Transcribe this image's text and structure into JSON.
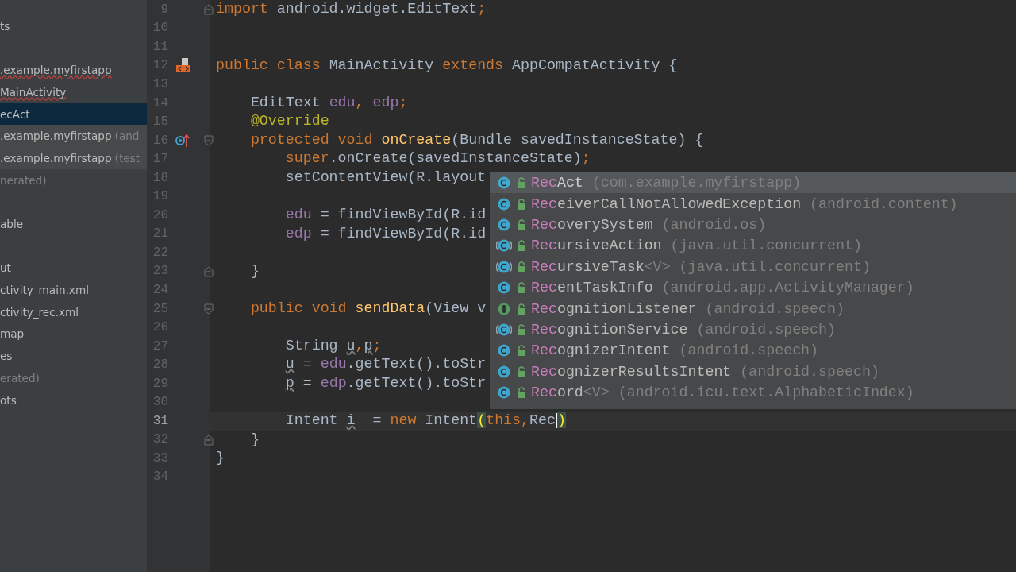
{
  "sidebar": {
    "groups": [
      [
        {
          "text": "ts",
          "kind": "plain",
          "selected": false
        }
      ],
      [
        {
          "text": ".example.myfirstapp",
          "kind": "error",
          "selected": false
        },
        {
          "text": "MainActivity",
          "kind": "error",
          "selected": false
        },
        {
          "text": "ecAct",
          "kind": "plain",
          "selected": true
        },
        {
          "text": ".example.myfirstapp",
          "note": "(and",
          "kind": "test",
          "selected": false
        },
        {
          "text": ".example.myfirstapp",
          "note": "(test",
          "kind": "test",
          "selected": false
        },
        {
          "text": "nerated)",
          "kind": "muted",
          "selected": false
        }
      ],
      [
        {
          "text": "able",
          "kind": "plain",
          "selected": false
        }
      ],
      [
        {
          "text": "ut",
          "kind": "plain",
          "selected": false
        },
        {
          "text": "ctivity_main.xml",
          "kind": "plain",
          "selected": false
        },
        {
          "text": "ctivity_rec.xml",
          "kind": "plain",
          "selected": false
        },
        {
          "text": "map",
          "kind": "plain",
          "selected": false
        },
        {
          "text": "es",
          "kind": "plain",
          "selected": false
        },
        {
          "text": "erated)",
          "kind": "muted",
          "selected": false
        },
        {
          "text": "ots",
          "kind": "plain",
          "selected": false
        }
      ]
    ]
  },
  "editor": {
    "lines": [
      {
        "number": "9",
        "gutter": [
          {
            "kind": "fold_end"
          }
        ],
        "current": false,
        "tokens": [
          {
            "text": "import ",
            "kind": "keyword"
          },
          {
            "text": "android.widget.EditText",
            "kind": "plain"
          },
          {
            "text": ";",
            "kind": "keyword"
          }
        ]
      },
      {
        "number": "10",
        "current": false
      },
      {
        "number": "11",
        "current": false
      },
      {
        "number": "12",
        "gutter": [
          {
            "kind": "layout"
          }
        ],
        "current": false,
        "tokens": [
          {
            "text": "public class ",
            "kind": "keyword"
          },
          {
            "text": "MainActivity ",
            "kind": "plain"
          },
          {
            "text": "extends ",
            "kind": "keyword"
          },
          {
            "text": "AppCompatActivity {",
            "kind": "plain"
          }
        ]
      },
      {
        "number": "13",
        "current": false
      },
      {
        "number": "14",
        "current": false,
        "tokens": [
          {
            "text": "    EditText ",
            "kind": "plain"
          },
          {
            "text": "edu",
            "kind": "field"
          },
          {
            "text": ", ",
            "kind": "keyword"
          },
          {
            "text": "edp",
            "kind": "field"
          },
          {
            "text": ";",
            "kind": "keyword"
          }
        ]
      },
      {
        "number": "15",
        "current": false,
        "tokens": [
          {
            "text": "    @Override",
            "kind": "annotation"
          }
        ]
      },
      {
        "number": "16",
        "gutter": [
          {
            "kind": "override"
          },
          {
            "kind": "fold_start"
          }
        ],
        "current": false,
        "tokens": [
          {
            "text": "    protected void ",
            "kind": "keyword"
          },
          {
            "text": "onCreate",
            "kind": "method"
          },
          {
            "text": "(Bundle savedInstanceState) {",
            "kind": "plain"
          }
        ]
      },
      {
        "number": "17",
        "current": false,
        "tokens": [
          {
            "text": "        super",
            "kind": "keyword"
          },
          {
            "text": ".onCreate(savedInstanceState)",
            "kind": "plain"
          },
          {
            "text": ";",
            "kind": "keyword"
          }
        ]
      },
      {
        "number": "18",
        "current": false,
        "tokens": [
          {
            "text": "        setContentView(R.layout",
            "kind": "plain"
          }
        ]
      },
      {
        "number": "19",
        "current": false
      },
      {
        "number": "20",
        "current": false,
        "tokens": [
          {
            "text": "        edu",
            "kind": "field"
          },
          {
            "text": " = findViewById(R.id",
            "kind": "plain"
          }
        ]
      },
      {
        "number": "21",
        "current": false,
        "tokens": [
          {
            "text": "        edp",
            "kind": "field"
          },
          {
            "text": " = findViewById(R.id",
            "kind": "plain"
          }
        ]
      },
      {
        "number": "22",
        "current": false
      },
      {
        "number": "23",
        "gutter": [
          {
            "kind": "fold_end"
          }
        ],
        "current": false,
        "tokens": [
          {
            "text": "    }",
            "kind": "plain"
          }
        ]
      },
      {
        "number": "24",
        "current": false
      },
      {
        "number": "25",
        "gutter": [
          {
            "kind": "fold_start"
          }
        ],
        "current": false,
        "tokens": [
          {
            "text": "    public void ",
            "kind": "keyword"
          },
          {
            "text": "sendData",
            "kind": "method"
          },
          {
            "text": "(View v",
            "kind": "plain"
          }
        ]
      },
      {
        "number": "26",
        "current": false
      },
      {
        "number": "27",
        "current": false,
        "tokens": [
          {
            "text": "        String ",
            "kind": "plain"
          },
          {
            "text": "u",
            "kind": "warning"
          },
          {
            "text": ",",
            "kind": "keyword"
          },
          {
            "text": "p",
            "kind": "warning"
          },
          {
            "text": ";",
            "kind": "keyword"
          }
        ]
      },
      {
        "number": "28",
        "current": false,
        "tokens": [
          {
            "text": "        u",
            "kind": "warning"
          },
          {
            "text": " = ",
            "kind": "plain"
          },
          {
            "text": "edu",
            "kind": "field"
          },
          {
            "text": ".getText().toStr",
            "kind": "plain"
          }
        ]
      },
      {
        "number": "29",
        "current": false,
        "tokens": [
          {
            "text": "        p",
            "kind": "warning"
          },
          {
            "text": " = ",
            "kind": "plain"
          },
          {
            "text": "edp",
            "kind": "field"
          },
          {
            "text": ".getText().toStr",
            "kind": "plain"
          }
        ]
      },
      {
        "number": "30",
        "current": false
      },
      {
        "number": "31",
        "current": true,
        "tokens": [
          {
            "text": "        Intent ",
            "kind": "plain"
          },
          {
            "text": "i",
            "kind": "warning"
          },
          {
            "text": "  = ",
            "kind": "plain"
          },
          {
            "text": "new ",
            "kind": "keyword"
          },
          {
            "text": "Intent",
            "kind": "plain"
          },
          {
            "text": "(",
            "kind": "brace"
          },
          {
            "text": "this",
            "kind": "keyword"
          },
          {
            "text": ",",
            "kind": "keyword"
          },
          {
            "text": "Rec",
            "kind": "plain",
            "caret": true
          },
          {
            "text": ")",
            "kind": "brace"
          }
        ]
      },
      {
        "number": "32",
        "gutter": [
          {
            "kind": "fold_end"
          }
        ],
        "current": false,
        "tokens": [
          {
            "text": "    }",
            "kind": "plain"
          }
        ]
      },
      {
        "number": "33",
        "current": false,
        "tokens": [
          {
            "text": "}",
            "kind": "plain"
          }
        ]
      },
      {
        "number": "34",
        "current": false
      }
    ]
  },
  "completion": {
    "items": [
      {
        "kind": "class",
        "match": "Rec",
        "rest": "Act",
        "package": "(com.example.myfirstapp)",
        "selected": true
      },
      {
        "kind": "class",
        "match": "Rec",
        "rest": "eiverCallNotAllowedException",
        "package": "(android.content)",
        "selected": false
      },
      {
        "kind": "class",
        "match": "Rec",
        "rest": "overySystem",
        "package": "(android.os)",
        "selected": false
      },
      {
        "kind": "abstract",
        "match": "Rec",
        "rest": "ursiveAction",
        "package": "(java.util.concurrent)",
        "selected": false
      },
      {
        "kind": "abstract",
        "match": "Rec",
        "rest": "ursiveTask",
        "generic": "<V>",
        "package": "(java.util.concurrent)",
        "selected": false
      },
      {
        "kind": "class",
        "match": "Rec",
        "rest": "entTaskInfo",
        "package": "(android.app.ActivityManager)",
        "selected": false
      },
      {
        "kind": "interface",
        "match": "Rec",
        "rest": "ognitionListener",
        "package": "(android.speech)",
        "selected": false
      },
      {
        "kind": "abstract",
        "match": "Rec",
        "rest": "ognitionService",
        "package": "(android.speech)",
        "selected": false
      },
      {
        "kind": "class",
        "match": "Rec",
        "rest": "ognizerIntent",
        "package": "(android.speech)",
        "selected": false
      },
      {
        "kind": "class",
        "match": "Rec",
        "rest": "ognizerResultsIntent",
        "package": "(android.speech)",
        "selected": false
      },
      {
        "kind": "class",
        "match": "Rec",
        "rest": "ord",
        "generic": "<V>",
        "package": "(android.icu.text.AlphabeticIndex)",
        "selected": false
      }
    ]
  }
}
